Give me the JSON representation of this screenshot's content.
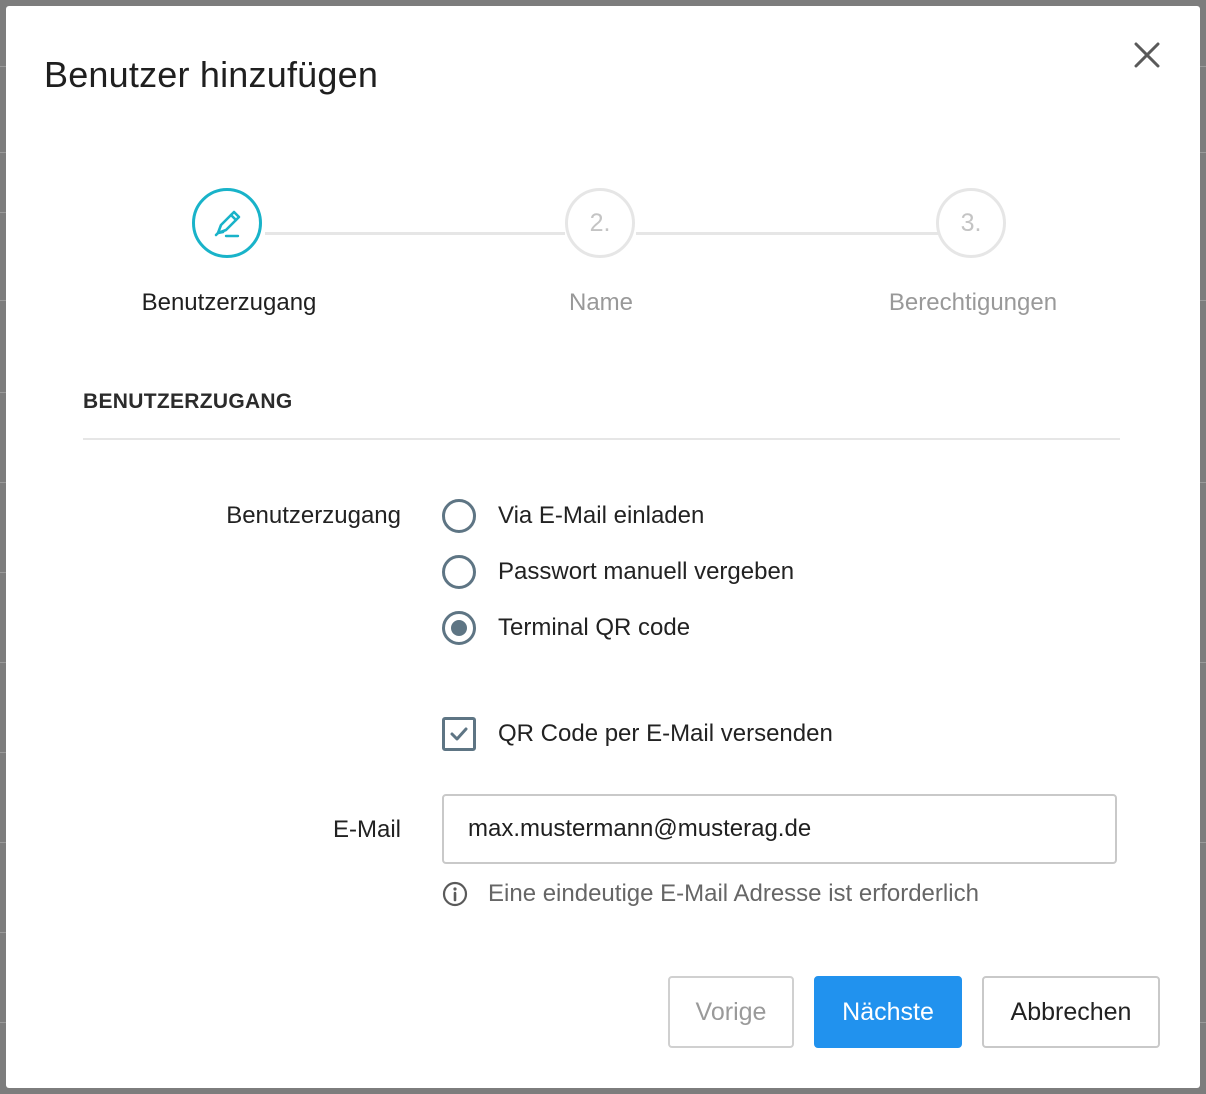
{
  "dialog": {
    "title": "Benutzer hinzufügen",
    "close_icon": "close-icon"
  },
  "stepper": {
    "steps": [
      {
        "marker": "",
        "icon": "pencil-icon",
        "label": "Benutzerzugang",
        "state": "active"
      },
      {
        "marker": "2.",
        "label": "Name",
        "state": "inactive"
      },
      {
        "marker": "3.",
        "label": "Berechtigungen",
        "state": "inactive"
      }
    ]
  },
  "section": {
    "heading": "BENUTZERZUGANG"
  },
  "access": {
    "label": "Benutzerzugang",
    "options": [
      {
        "label": "Via E-Mail einladen",
        "selected": false
      },
      {
        "label": "Passwort manuell vergeben",
        "selected": false
      },
      {
        "label": "Terminal QR code",
        "selected": true
      }
    ]
  },
  "qr_email": {
    "label": "QR Code per E-Mail versenden",
    "checked": true
  },
  "email": {
    "label": "E-Mail",
    "value": "max.mustermann@musterag.de",
    "hint": "Eine eindeutige E-Mail Adresse ist erforderlich",
    "hint_icon": "info-icon"
  },
  "footer": {
    "prev_label": "Vorige",
    "next_label": "Nächste",
    "cancel_label": "Abbrechen"
  },
  "colors": {
    "accent": "#19b3c9",
    "primary_button": "#2192ee",
    "control": "#5e7584"
  }
}
